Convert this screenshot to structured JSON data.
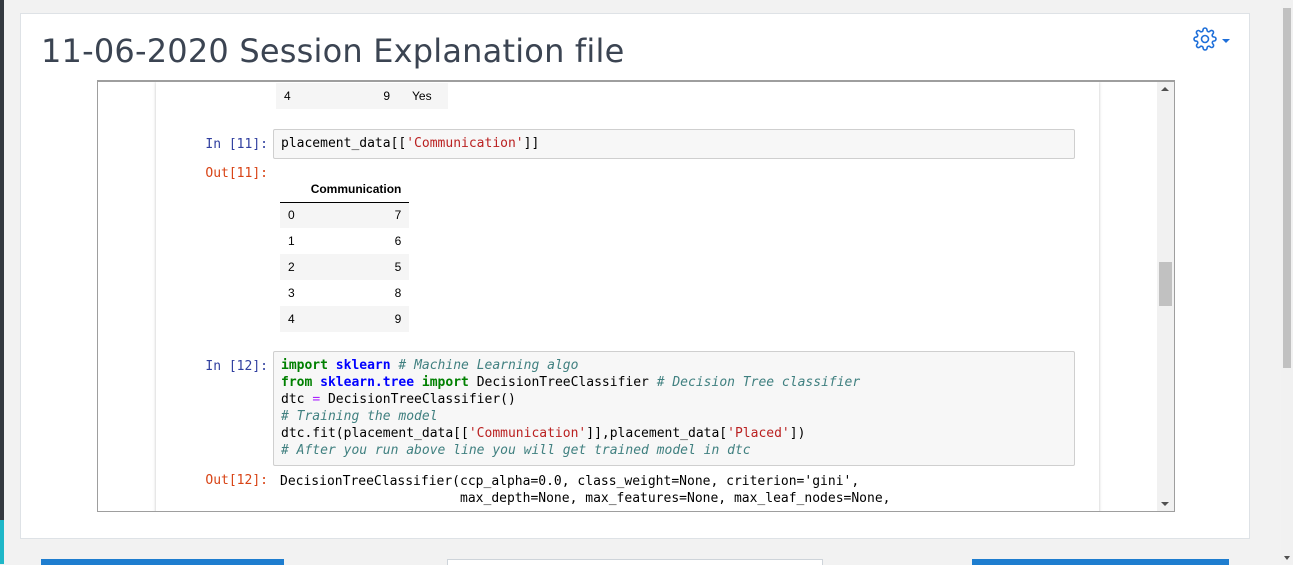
{
  "page": {
    "title": "11-06-2020 Session Explanation file",
    "settings_icon": "gear-icon",
    "accent_color": "#1e7dcf"
  },
  "notebook": {
    "prev_output": {
      "row": {
        "index": "4",
        "value": "9",
        "extra": "Yes"
      }
    },
    "cell11": {
      "in_prompt": "In [11]:",
      "code": {
        "a": "placement_data[[",
        "b": "'Communication'",
        "c": "]]"
      },
      "out_prompt": "Out[11]:",
      "table": {
        "header": "Communication",
        "rows": [
          {
            "index": "0",
            "value": "7"
          },
          {
            "index": "1",
            "value": "6"
          },
          {
            "index": "2",
            "value": "5"
          },
          {
            "index": "3",
            "value": "8"
          },
          {
            "index": "4",
            "value": "9"
          }
        ]
      }
    },
    "cell12": {
      "in_prompt": "In [12]:",
      "line1": {
        "kw": "import",
        "mod": "sklearn",
        "comment": "# Machine Learning algo"
      },
      "line2": {
        "kw1": "from",
        "mod": "sklearn.tree",
        "kw2": "import",
        "name": "DecisionTreeClassifier",
        "comment": "# Decision Tree classifier"
      },
      "line3": {
        "a": "dtc",
        "op": "=",
        "b": "DecisionTreeClassifier()"
      },
      "line4": {
        "comment": "# Training the model"
      },
      "line5": {
        "a": "dtc.fit(placement_data[[",
        "s1": "'Communication'",
        "b": "]],placement_data[",
        "s2": "'Placed'",
        "c": "])"
      },
      "line6": {
        "comment": "# After you run above line you will get trained model in dtc"
      },
      "out_prompt": "Out[12]:",
      "output_line1": "DecisionTreeClassifier(ccp_alpha=0.0, class_weight=None, criterion='gini',",
      "output_line2": "                       max_depth=None, max_features=None, max_leaf_nodes=None,"
    }
  }
}
